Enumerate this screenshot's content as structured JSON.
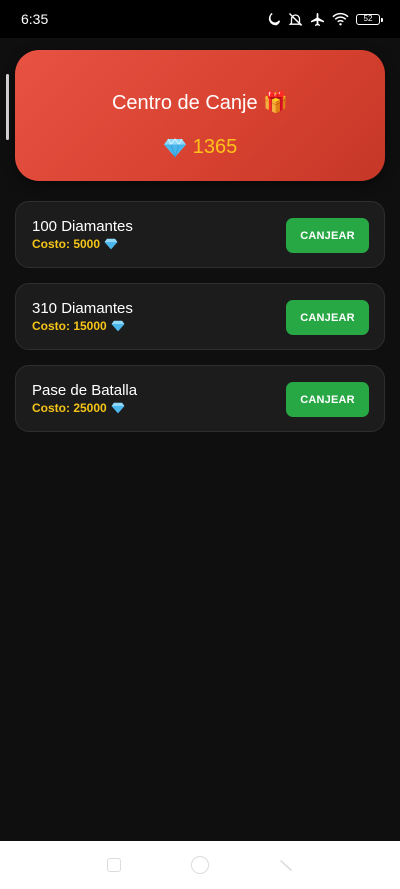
{
  "status_bar": {
    "time": "6:35",
    "battery": "52"
  },
  "header": {
    "title": "Centro de Canje 🎁",
    "balance": "1365",
    "gradient_start": "#e85243",
    "gradient_end": "#c53728",
    "balance_color": "#ffc21a"
  },
  "items": [
    {
      "name": "100 Diamantes",
      "cost": "Costo: 5000",
      "button": "CANJEAR"
    },
    {
      "name": "310 Diamantes",
      "cost": "Costo: 15000",
      "button": "CANJEAR"
    },
    {
      "name": "Pase de Batalla",
      "cost": "Costo: 25000",
      "button": "CANJEAR"
    }
  ],
  "colors": {
    "background": "#0f0f0f",
    "card": "#1c1c1c",
    "button": "#28a745",
    "cost_text": "#f5c418"
  },
  "icons": {
    "diamond": "gem-icon",
    "gift": "gift-icon"
  }
}
